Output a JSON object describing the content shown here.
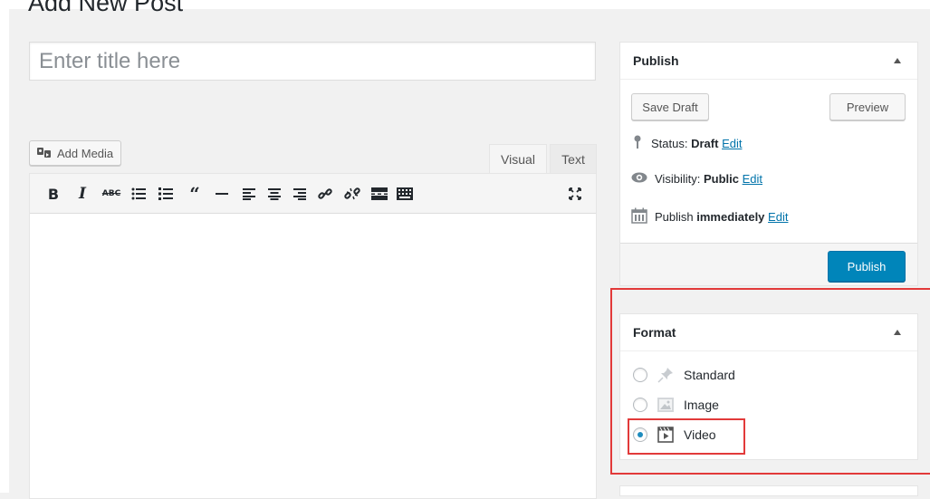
{
  "page": {
    "title": "Add New Post"
  },
  "title_field": {
    "placeholder": "Enter title here",
    "value": ""
  },
  "media": {
    "add_media_label": "Add Media"
  },
  "editor_tabs": {
    "visual": "Visual",
    "text": "Text"
  },
  "toolbar": {
    "buttons": [
      "bold",
      "italic",
      "strikethrough",
      "bulleted-list",
      "numbered-list",
      "blockquote",
      "horizontal-line",
      "align-left",
      "align-center",
      "align-right",
      "insert-link",
      "remove-link",
      "insert-more",
      "toolbar-toggle",
      "distraction-free"
    ]
  },
  "publish": {
    "header": "Publish",
    "save_draft": "Save Draft",
    "preview": "Preview",
    "status_label": "Status:",
    "status_value": "Draft",
    "visibility_label": "Visibility:",
    "visibility_value": "Public",
    "publish_label": "Publish",
    "publish_value": "immediately",
    "edit_link": "Edit",
    "publish_button": "Publish"
  },
  "format": {
    "header": "Format",
    "options": [
      {
        "label": "Standard",
        "icon": "pushpin-icon",
        "checked": false
      },
      {
        "label": "Image",
        "icon": "image-icon",
        "checked": false
      },
      {
        "label": "Video",
        "icon": "video-icon",
        "checked": true
      }
    ]
  },
  "colors": {
    "accent": "#0085ba",
    "link": "#0073aa",
    "highlight": "#e23a3a",
    "radio_checked": "#1e8cbe"
  }
}
